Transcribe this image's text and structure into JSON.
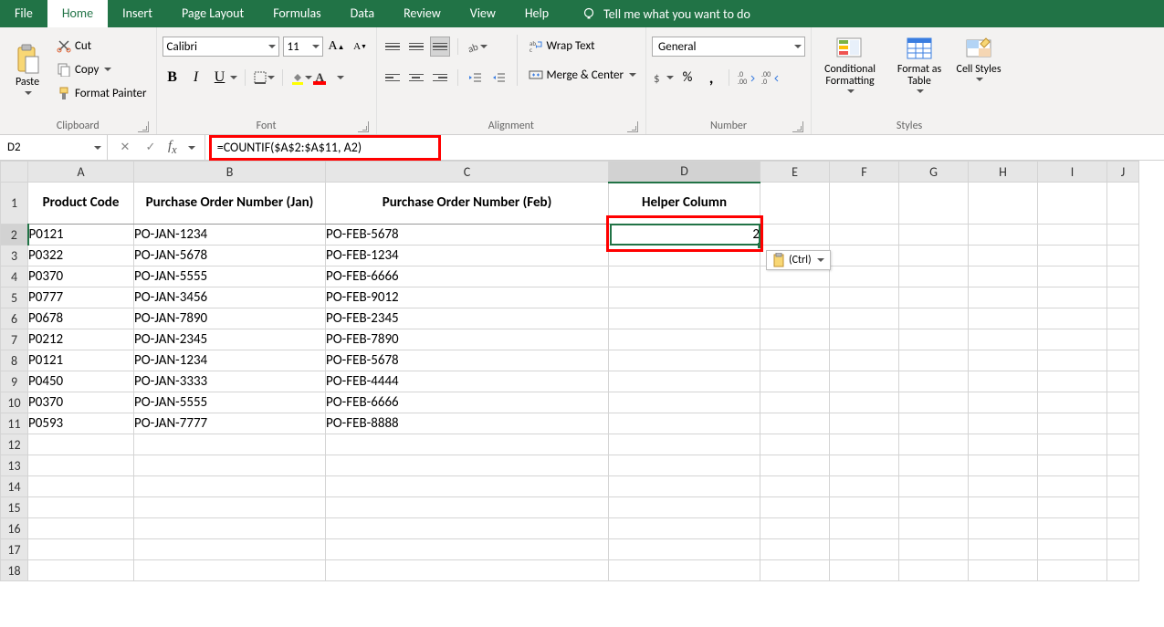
{
  "tabs": {
    "file": "File",
    "home": "Home",
    "insert": "Insert",
    "page_layout": "Page Layout",
    "formulas": "Formulas",
    "data": "Data",
    "review": "Review",
    "view": "View",
    "help": "Help",
    "tell_me": "Tell me what you want to do"
  },
  "ribbon": {
    "clipboard": {
      "paste": "Paste",
      "cut": "Cut",
      "copy": "Copy",
      "format_painter": "Format Painter",
      "group": "Clipboard"
    },
    "font": {
      "name": "Calibri",
      "size": "11",
      "group": "Font"
    },
    "alignment": {
      "wrap": "Wrap Text",
      "merge": "Merge & Center",
      "group": "Alignment"
    },
    "number": {
      "format": "General",
      "group": "Number"
    },
    "styles": {
      "conditional": "Conditional Formatting",
      "format_as": "Format as Table",
      "cell_styles": "Cell Styles",
      "group": "Styles"
    }
  },
  "name_box": "D2",
  "formula": "=COUNTIF($A$2:$A$11, A2)",
  "columns": [
    "A",
    "B",
    "C",
    "D",
    "E",
    "F",
    "G",
    "H",
    "I",
    "J"
  ],
  "headers": {
    "A": "Product Code",
    "B": "Purchase Order Number (Jan)",
    "C": "Purchase Order Number (Feb)",
    "D": "Helper Column"
  },
  "rows": [
    {
      "A": "P0121",
      "B": "PO-JAN-1234",
      "C": "PO-FEB-5678",
      "D": "2"
    },
    {
      "A": "P0322",
      "B": "PO-JAN-5678",
      "C": "PO-FEB-1234",
      "D": ""
    },
    {
      "A": "P0370",
      "B": "PO-JAN-5555",
      "C": "PO-FEB-6666",
      "D": ""
    },
    {
      "A": "P0777",
      "B": "PO-JAN-3456",
      "C": "PO-FEB-9012",
      "D": ""
    },
    {
      "A": "P0678",
      "B": "PO-JAN-7890",
      "C": "PO-FEB-2345",
      "D": ""
    },
    {
      "A": "P0212",
      "B": "PO-JAN-2345",
      "C": "PO-FEB-7890",
      "D": ""
    },
    {
      "A": "P0121",
      "B": "PO-JAN-1234",
      "C": "PO-FEB-5678",
      "D": ""
    },
    {
      "A": "P0450",
      "B": "PO-JAN-3333",
      "C": "PO-FEB-4444",
      "D": ""
    },
    {
      "A": "P0370",
      "B": "PO-JAN-5555",
      "C": "PO-FEB-6666",
      "D": ""
    },
    {
      "A": "P0593",
      "B": "PO-JAN-7777",
      "C": "PO-FEB-8888",
      "D": ""
    }
  ],
  "paste_popup": "(Ctrl)"
}
